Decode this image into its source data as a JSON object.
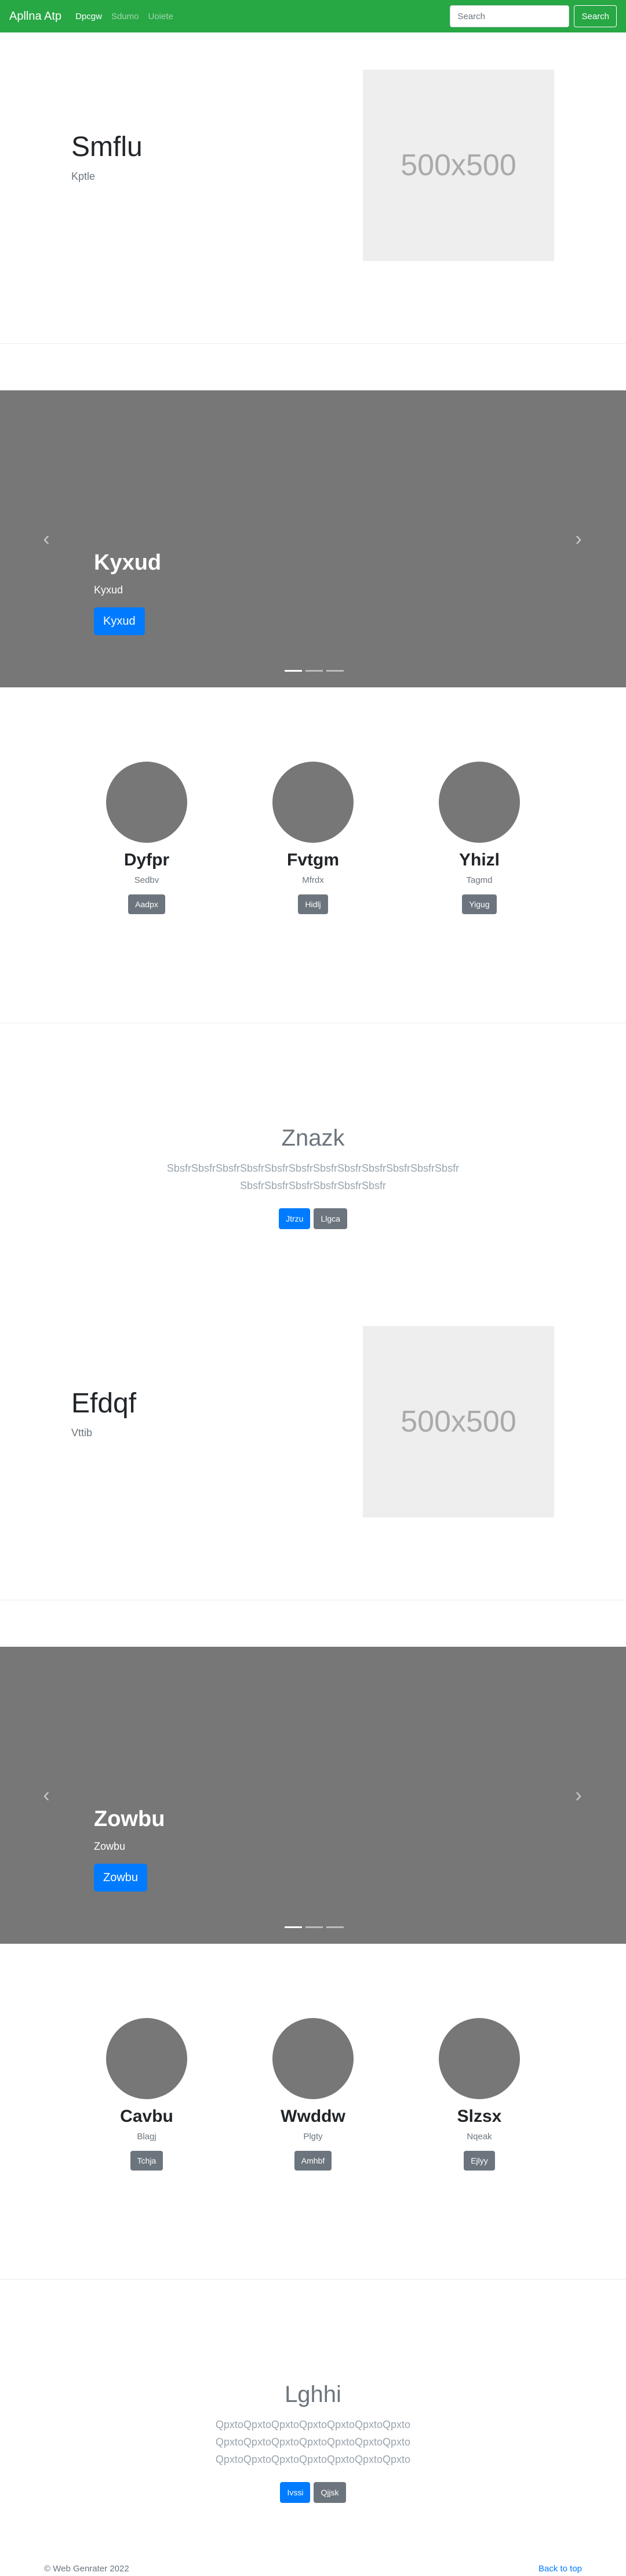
{
  "navbar": {
    "brand": "Apllna Atp",
    "links": [
      "Dpcgw",
      "Sdumo",
      "Uoiete"
    ],
    "search_placeholder": "Search",
    "search_button": "Search"
  },
  "features": [
    {
      "title": "Smflu",
      "subtitle": "Kptle",
      "image_label": "500x500"
    },
    {
      "title": "Efdqf",
      "subtitle": "Vttib",
      "image_label": "500x500"
    }
  ],
  "carousels": [
    {
      "title": "Kyxud",
      "text": "Kyxud",
      "button": "Kyxud",
      "prev_icon": "chevron-left",
      "next_icon": "chevron-right"
    },
    {
      "title": "Zowbu",
      "text": "Zowbu",
      "button": "Zowbu",
      "prev_icon": "chevron-left",
      "next_icon": "chevron-right"
    }
  ],
  "people_rows": [
    [
      {
        "name": "Dyfpr",
        "desc": "Sedbv",
        "button": "Aadpx"
      },
      {
        "name": "Fvtgm",
        "desc": "Mfrdx",
        "button": "Hidlj"
      },
      {
        "name": "Yhizl",
        "desc": "Tagmd",
        "button": "Yigug"
      }
    ],
    [
      {
        "name": "Cavbu",
        "desc": "Blagj",
        "button": "Tchja"
      },
      {
        "name": "Wwddw",
        "desc": "Plgty",
        "button": "Amhbf"
      },
      {
        "name": "Slzsx",
        "desc": "Nqeak",
        "button": "Ejlyy"
      }
    ]
  ],
  "jumbotrons": [
    {
      "title": "Znazk",
      "lines": [
        "SbsfrSbsfrSbsfrSbsfrSbsfrSbsfrSbsfrSbsfrSbsfrSbsfrSbsfrSbsfr",
        "SbsfrSbsfrSbsfrSbsfrSbsfrSbsfr"
      ],
      "primary": "Jtrzu",
      "secondary": "Llgca"
    },
    {
      "title": "Lghhi",
      "lines": [
        "QpxtoQpxtoQpxtoQpxtoQpxtoQpxtoQpxto",
        "QpxtoQpxtoQpxtoQpxtoQpxtoQpxtoQpxto",
        "QpxtoQpxtoQpxtoQpxtoQpxtoQpxtoQpxto"
      ],
      "primary": "Ivssi",
      "secondary": "Qjjsk"
    }
  ],
  "footer": {
    "copyright": "© Web Genrater 2022",
    "back_to_top": "Back to top"
  },
  "colors": {
    "navbar": "#28a745",
    "primary": "#007bff",
    "secondary": "#6c757d",
    "carousel_bg": "#777777",
    "placeholder_bg": "#eeeeee"
  }
}
